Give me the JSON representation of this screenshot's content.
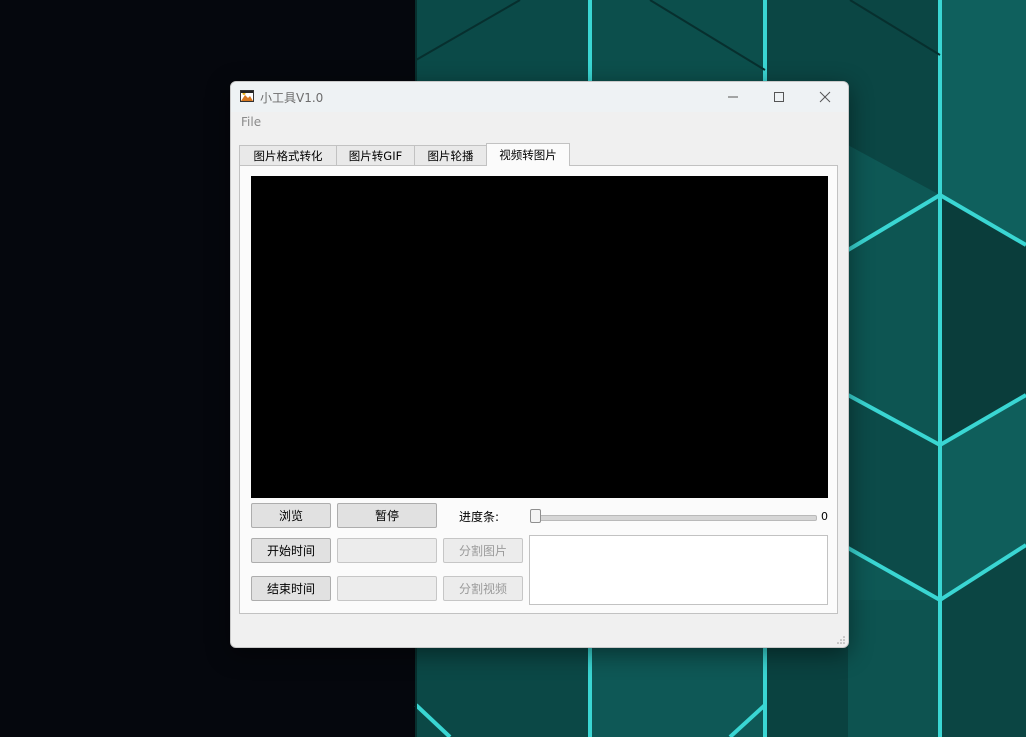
{
  "window": {
    "title": "小工具V1.0",
    "icon": "picture-icon"
  },
  "menu": {
    "file": "File"
  },
  "tabs": [
    {
      "label": "图片格式转化",
      "active": false
    },
    {
      "label": "图片转GIF",
      "active": false
    },
    {
      "label": "图片轮播",
      "active": false
    },
    {
      "label": "视频转图片",
      "active": true
    }
  ],
  "controls": {
    "browse": "浏览",
    "pause": "暂停",
    "progress_label": "进度条:",
    "progress_value": 0,
    "start_time": "开始时间",
    "end_time": "结束时间",
    "split_images": "分割图片",
    "split_video": "分割视频",
    "start_time_value": "",
    "end_time_value": "",
    "output_text": ""
  },
  "colors": {
    "teal": "#0f5f5c",
    "teal_dark": "#0a3f3d",
    "teal_edge": "#3ad6d3",
    "desktop_dark": "#05070d"
  }
}
